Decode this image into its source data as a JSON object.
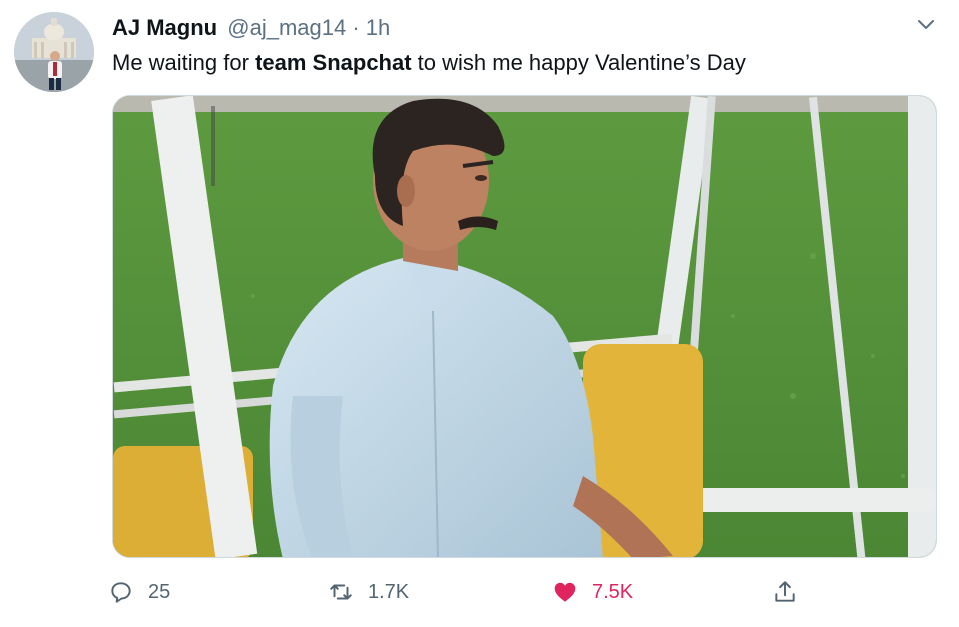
{
  "tweet": {
    "author_name": "AJ Magnu",
    "handle": "@aj_mag14",
    "separator": "·",
    "time": "1h",
    "text_before": "Me waiting for ",
    "text_bold": "team Snapchat",
    "text_after": " to wish me happy Valentine’s Day"
  },
  "media": {
    "description_icon": "photo"
  },
  "actions": {
    "reply_count": "25",
    "retweet_count": "1.7K",
    "like_count": "7.5K",
    "liked": true
  },
  "colors": {
    "like_accent": "#e0245e",
    "secondary_text": "#5b7083"
  },
  "icons": {
    "reply": "reply-icon",
    "retweet": "retweet-icon",
    "like": "heart-icon",
    "share": "share-icon",
    "more": "chevron-down-icon"
  }
}
